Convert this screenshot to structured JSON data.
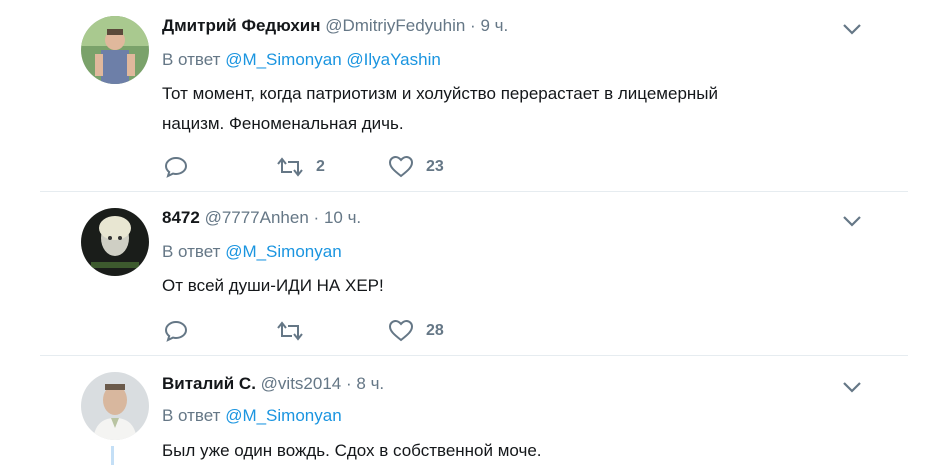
{
  "tweets": [
    {
      "name": "Дмитрий Федюхин",
      "handle": "@DmitriyFedyuhin",
      "dot": "·",
      "time": "9 ч.",
      "reply_prefix": "В ответ",
      "mentions": [
        "@M_Simonyan",
        "@IlyaYashin"
      ],
      "text_lines": [
        "Тот момент, когда патриотизм и холуйство перерастает в лицемерный",
        "нацизм. Феноменальная дичь."
      ],
      "retweets": "2",
      "likes": "23"
    },
    {
      "name": "8472",
      "handle": "@7777Anhen",
      "dot": "·",
      "time": "10 ч.",
      "reply_prefix": "В ответ",
      "mentions": [
        "@M_Simonyan"
      ],
      "text_lines": [
        "От всей души-ИДИ НА ХЕР!"
      ],
      "retweets": "",
      "likes": "28"
    },
    {
      "name": "Виталий С.",
      "handle": "@vits2014",
      "dot": "·",
      "time": "8 ч.",
      "reply_prefix": "В ответ",
      "mentions": [
        "@M_Simonyan"
      ],
      "text_lines": [
        "Был уже один вождь. Сдох в собственной моче."
      ]
    }
  ],
  "colors": {
    "link": "#1b95e0",
    "secondary": "#657786",
    "text": "#14171a",
    "separator": "#e6ecf0"
  },
  "icons": {
    "reply": "reply-icon",
    "retweet": "retweet-icon",
    "like": "heart-icon",
    "menu": "chevron-down-icon"
  }
}
